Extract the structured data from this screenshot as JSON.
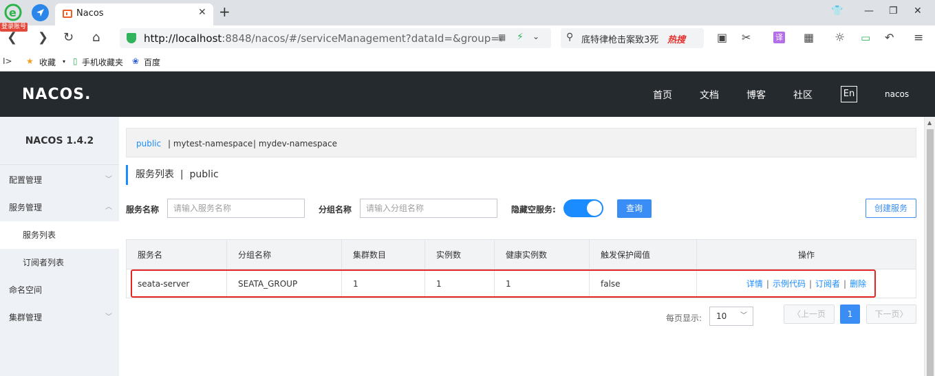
{
  "browser": {
    "badge": "登录账号",
    "tab_title": "Nacos",
    "tab_close": "✕",
    "new_tab": "+",
    "url_host": "http://localhost",
    "url_rest": ":8848/nacos/#/serviceManagement?dataId=&group=&app",
    "search_text": "底特律枪击案致3死",
    "search_hot": "热搜",
    "bookmarks": {
      "favorites": "收藏",
      "mobile": "手机收藏夹",
      "baidu": "百度"
    }
  },
  "header": {
    "logo": "NACOS.",
    "menu": [
      "首页",
      "文档",
      "博客",
      "社区"
    ],
    "lang": "En",
    "user": "nacos"
  },
  "sidebar": {
    "version": "NACOS 1.4.2",
    "items": [
      {
        "label": "配置管理"
      },
      {
        "label": "服务管理"
      },
      {
        "label": "服务列表"
      },
      {
        "label": "订阅者列表"
      },
      {
        "label": "命名空间"
      },
      {
        "label": "集群管理"
      }
    ]
  },
  "namespaces": [
    "public",
    "| mytest-namespace",
    "| mydev-namespace"
  ],
  "page": {
    "title": "服务列表",
    "separator": "|",
    "namespace": "public"
  },
  "filters": {
    "service_name_label": "服务名称",
    "service_name_placeholder": "请输入服务名称",
    "group_name_label": "分组名称",
    "group_name_placeholder": "请输入分组名称",
    "hide_empty_label": "隐藏空服务:",
    "query_button": "查询",
    "create_button": "创建服务"
  },
  "table": {
    "headers": [
      "服务名",
      "分组名称",
      "集群数目",
      "实例数",
      "健康实例数",
      "触发保护阈值",
      "操作"
    ],
    "rows": [
      {
        "service": "seata-server",
        "group": "SEATA_GROUP",
        "clusters": "1",
        "instances": "1",
        "healthy": "1",
        "threshold": "false",
        "actions": [
          "详情",
          "示例代码",
          "订阅者",
          "删除"
        ]
      }
    ]
  },
  "pagination": {
    "per_page_label": "每页显示:",
    "per_page": "10",
    "prev": "上一页",
    "current": "1",
    "next": "下一页"
  },
  "colors": {
    "accent": "#1a8cff",
    "header_bg": "#252a2f",
    "highlight": "#e32525"
  }
}
